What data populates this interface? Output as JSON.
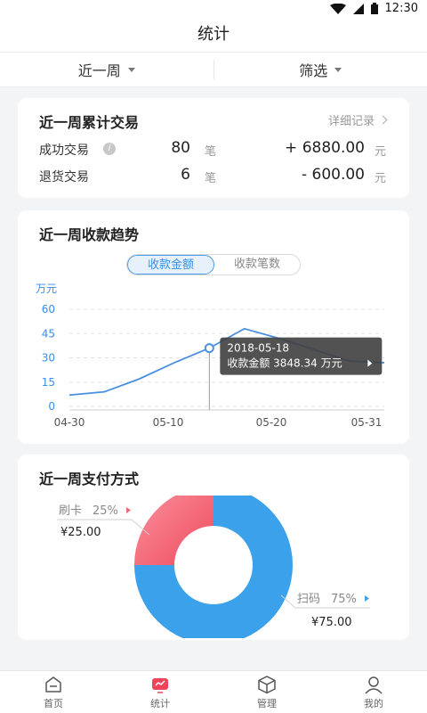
{
  "status": {
    "time": "12:30"
  },
  "header": {
    "title": "统计"
  },
  "filters": {
    "period": "近一周",
    "filter": "筛选"
  },
  "trade_card": {
    "title": "近一周累计交易",
    "detail_link": "详细记录",
    "rows": [
      {
        "label": "成功交易",
        "count": "80",
        "count_unit": "笔",
        "amount": "+ 6880.00",
        "amount_unit": "元"
      },
      {
        "label": "退货交易",
        "count": "6",
        "count_unit": "笔",
        "amount": "- 600.00",
        "amount_unit": "元"
      }
    ]
  },
  "trend_card": {
    "title": "近一周收款趋势",
    "tabs": [
      "收款金额",
      "收款笔数"
    ],
    "active_tab": 0,
    "tooltip": {
      "date": "2018-05-18",
      "text": "收款金额 3848.34 万元"
    }
  },
  "pay_card": {
    "title": "近一周支付方式"
  },
  "nav": [
    {
      "label": "首页",
      "icon": "home-icon"
    },
    {
      "label": "统计",
      "icon": "chart-icon"
    },
    {
      "label": "管理",
      "icon": "box-icon"
    },
    {
      "label": "我的",
      "icon": "user-icon"
    }
  ],
  "colors": {
    "accent": "#3a8ee6",
    "line": "#4a90e2",
    "donut_blue": "#3ba1ea",
    "donut_red": "#f06874"
  },
  "chart_data": [
    {
      "type": "line",
      "ylabel": "万元",
      "ylim": [
        0,
        60
      ],
      "yticks": [
        0,
        15,
        30,
        45,
        60
      ],
      "x_tick_labels": [
        "04-30",
        "05-10",
        "05-20",
        "05-31"
      ],
      "x": [
        "04-30",
        "05-04",
        "05-08",
        "05-12",
        "05-15",
        "05-18",
        "05-21",
        "05-24",
        "05-27",
        "05-31"
      ],
      "values": [
        7,
        9,
        17,
        27,
        36,
        48,
        42,
        35,
        28,
        27
      ],
      "highlight_index": 4,
      "grid": true
    },
    {
      "type": "pie",
      "labels": [
        "刷卡",
        "扫码"
      ],
      "values": [
        25,
        75
      ],
      "percent_labels": [
        "25%",
        "75%"
      ],
      "amount_labels": [
        "¥25.00",
        "¥75.00"
      ]
    }
  ]
}
